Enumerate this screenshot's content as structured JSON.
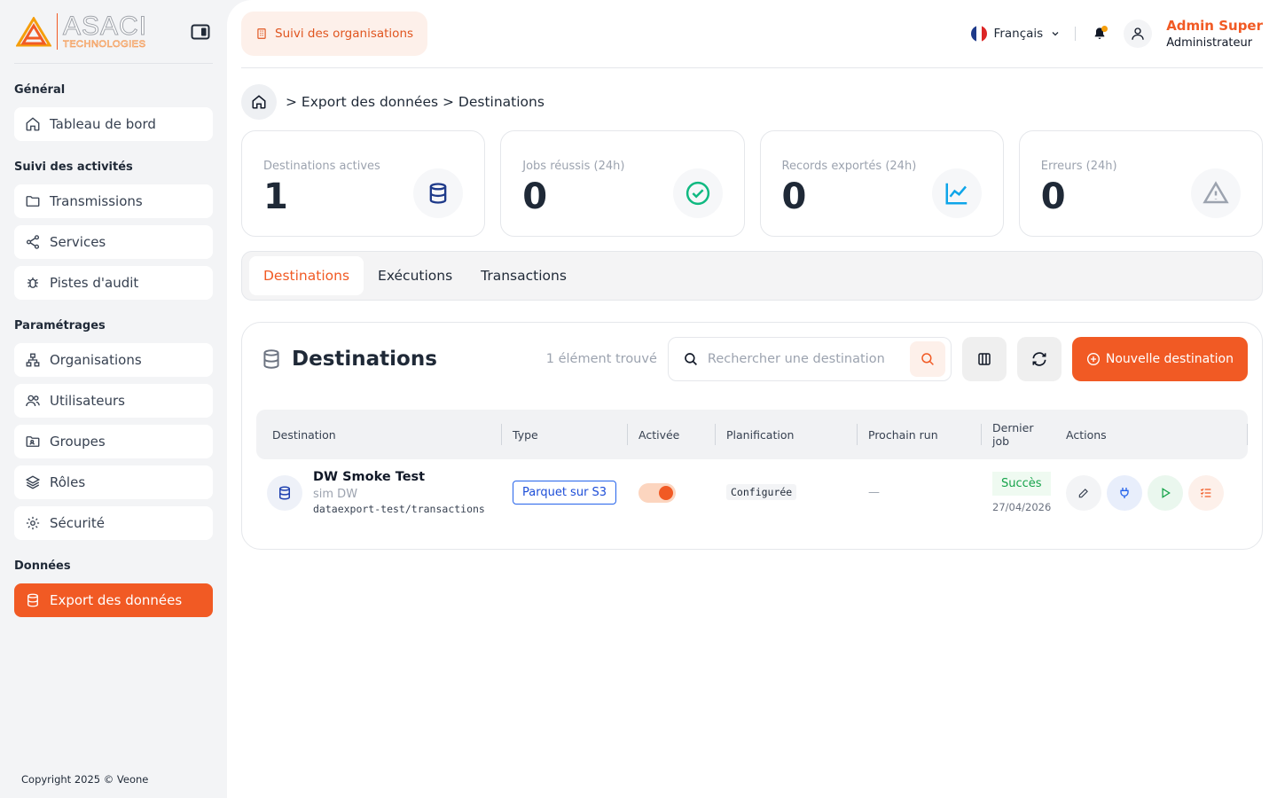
{
  "brand": {
    "name": "ASACI",
    "tagline": "TECHNOLOGIES",
    "accent": "#f15a24"
  },
  "sidebar": {
    "sections": [
      {
        "title": "Général",
        "items": [
          {
            "label": "Tableau de bord",
            "icon": "home-icon"
          }
        ]
      },
      {
        "title": "Suivi des activités",
        "items": [
          {
            "label": "Transmissions",
            "icon": "folder-icon"
          },
          {
            "label": "Services",
            "icon": "send-icon"
          },
          {
            "label": "Pistes d'audit",
            "icon": "bug-icon"
          }
        ]
      },
      {
        "title": "Paramétrages",
        "items": [
          {
            "label": "Organisations",
            "icon": "org-icon"
          },
          {
            "label": "Utilisateurs",
            "icon": "users-icon"
          },
          {
            "label": "Groupes",
            "icon": "group-icon"
          },
          {
            "label": "Rôles",
            "icon": "layers-icon"
          },
          {
            "label": "Sécurité",
            "icon": "gear-icon"
          }
        ]
      },
      {
        "title": "Données",
        "items": [
          {
            "label": "Export des données",
            "icon": "database-icon",
            "active": true
          }
        ]
      }
    ],
    "copyright": "Copyright 2025 © Veone"
  },
  "topbar": {
    "org_button": "Suivi des organisations",
    "language": "Français",
    "user_name": "Admin Super",
    "user_role": "Administrateur"
  },
  "breadcrumb": "> Export des données > Destinations",
  "stats": [
    {
      "label": "Destinations actives",
      "value": "1",
      "icon": "database-icon",
      "color": "#1e3a8a"
    },
    {
      "label": "Jobs réussis (24h)",
      "value": "0",
      "icon": "check-circle-icon",
      "color": "#10b981"
    },
    {
      "label": "Records exportés (24h)",
      "value": "0",
      "icon": "chart-line-icon",
      "color": "#0ea5e9"
    },
    {
      "label": "Erreurs (24h)",
      "value": "0",
      "icon": "warning-icon",
      "color": "#9ca3af"
    }
  ],
  "tabs": [
    {
      "label": "Destinations",
      "active": true
    },
    {
      "label": "Exécutions"
    },
    {
      "label": "Transactions"
    }
  ],
  "card": {
    "title": "Destinations",
    "count": "1 élément trouvé",
    "search_placeholder": "Rechercher une destination",
    "new_button": "Nouvelle destination"
  },
  "table": {
    "columns": [
      "Destination",
      "Type",
      "Activée",
      "Planification",
      "Prochain run",
      "Dernier job",
      "Actions"
    ],
    "rows": [
      {
        "name": "DW Smoke Test",
        "sub": "sim DW",
        "path": "dataexport-test/transactions",
        "type": "Parquet sur S3",
        "enabled": true,
        "planning": "Configurée",
        "next_run": "—",
        "last_job_status": "Succès",
        "last_job_date": "27/04/2026"
      }
    ]
  }
}
